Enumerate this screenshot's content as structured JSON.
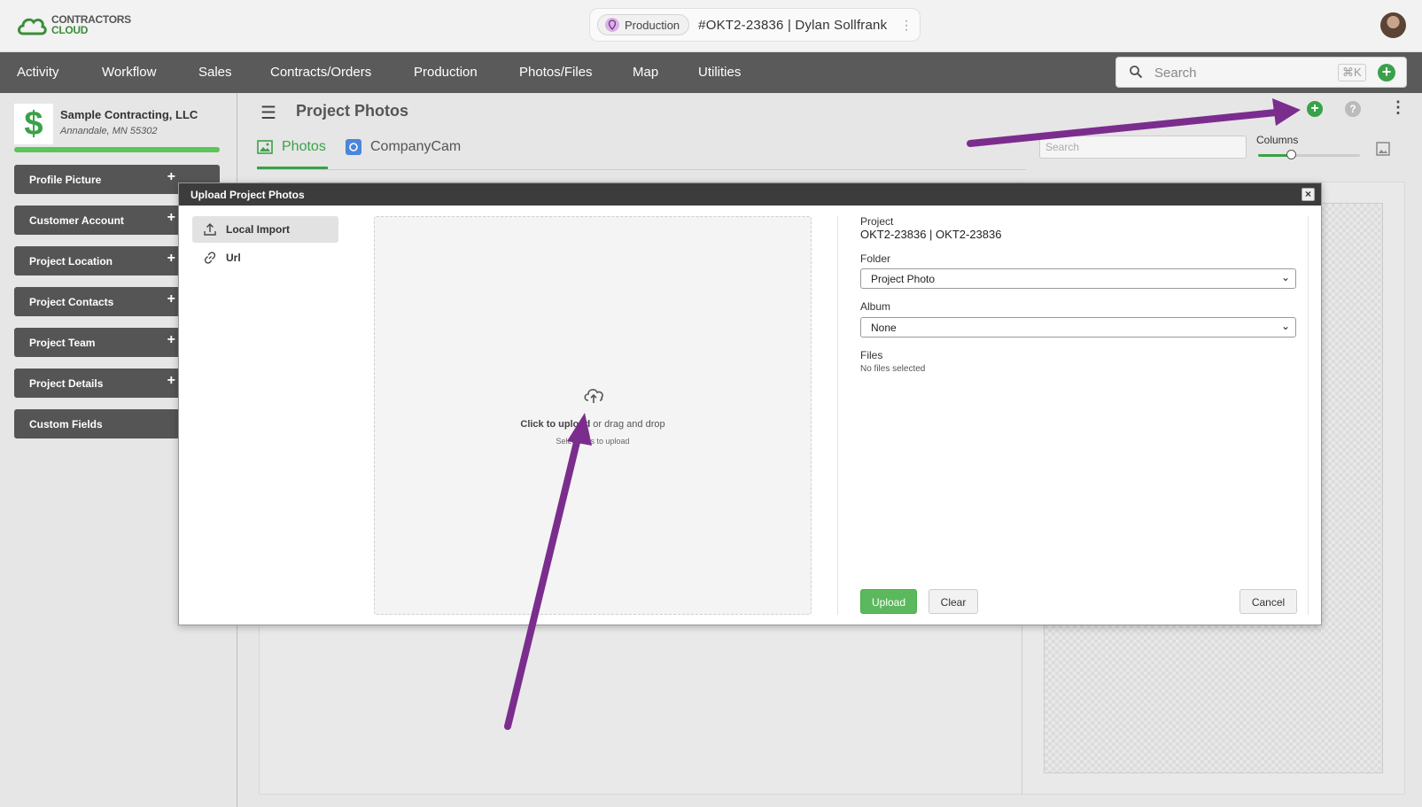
{
  "brand": {
    "line1": "CONTRACTORS",
    "line2": "CLOUD"
  },
  "project_pill": {
    "badge": "Production",
    "title": "#OKT2-23836 | Dylan Sollfrank"
  },
  "nav": {
    "items": [
      "Activity",
      "Workflow",
      "Sales",
      "Contracts/Orders",
      "Production",
      "Photos/Files",
      "Map",
      "Utilities"
    ]
  },
  "global_search": {
    "placeholder": "Search",
    "shortcut": "⌘K"
  },
  "sidebar": {
    "company_name": "Sample Contracting, LLC",
    "company_location": "Annandale, MN 55302",
    "progress": 1.0,
    "items": [
      "Profile Picture",
      "Customer Account",
      "Project Location",
      "Project Contacts",
      "Project Team",
      "Project Details",
      "Custom Fields"
    ]
  },
  "main": {
    "title": "Project Photos",
    "tabs": [
      "Photos",
      "CompanyCam"
    ],
    "search_placeholder": "Search",
    "columns_label": "Columns",
    "columns_level": 0.32
  },
  "modal": {
    "title": "Upload Project Photos",
    "sources": [
      "Local Import",
      "Url"
    ],
    "dropzone": {
      "click_text": "Click to upload",
      "rest_text": " or drag and drop",
      "sub_text": "Select files to upload"
    },
    "project_label": "Project",
    "project_value": "OKT2-23836 | OKT2-23836",
    "folder_label": "Folder",
    "folder_value": "Project Photo",
    "album_label": "Album",
    "album_value": "None",
    "files_label": "Files",
    "files_value": "No files selected",
    "upload_button": "Upload",
    "clear_button": "Clear",
    "cancel_button": "Cancel"
  },
  "colors": {
    "accent_green": "#3aa14a",
    "nav_bg": "#5a5a5a",
    "annotation_purple": "#7b2d8e"
  }
}
